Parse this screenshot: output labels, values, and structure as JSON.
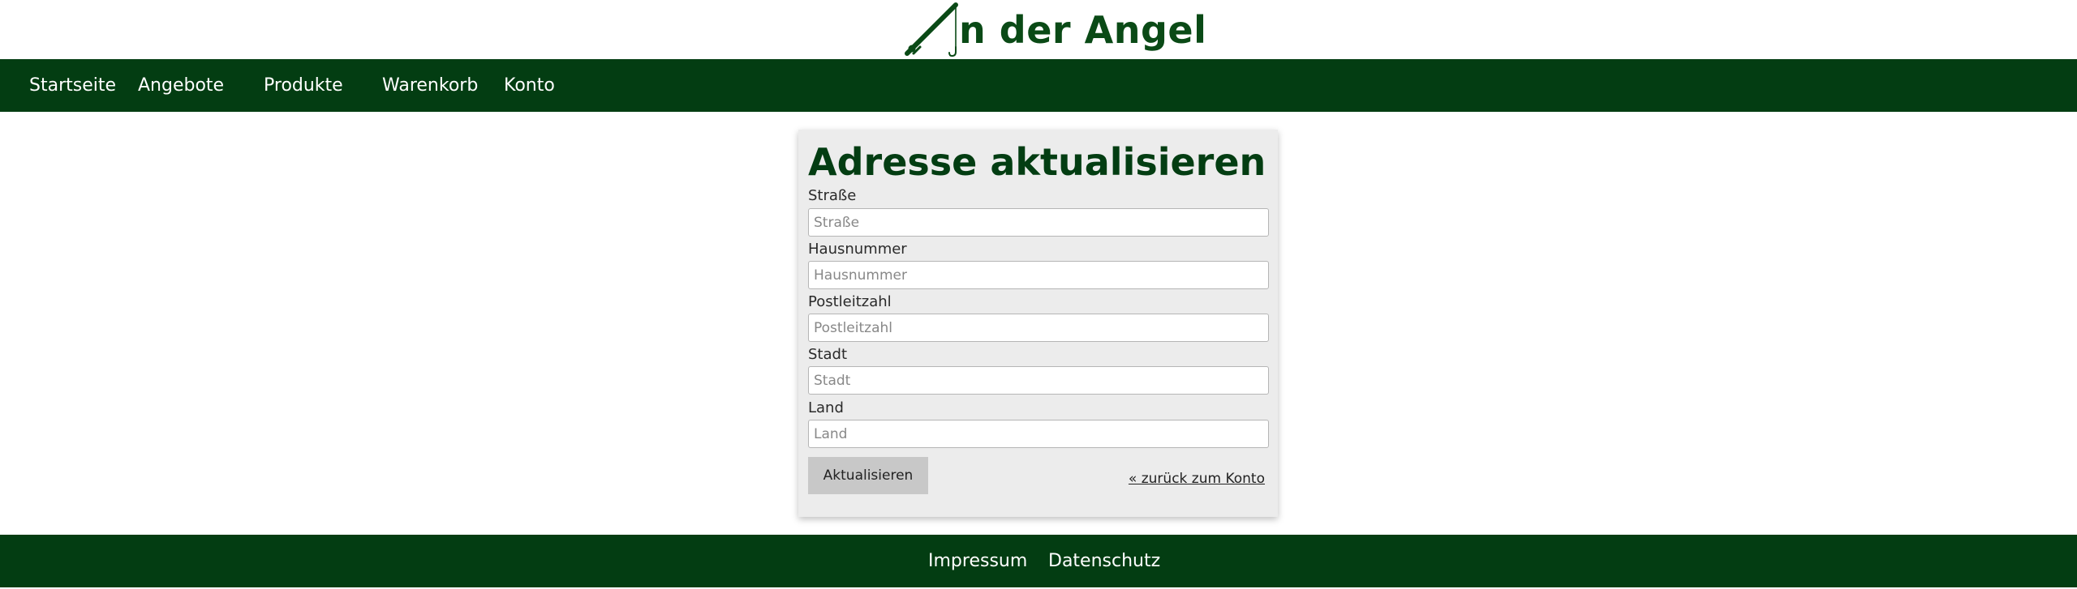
{
  "brand": {
    "logo_text": "n der Angel",
    "logo_icon": "fishing-rod-icon",
    "color": "#0a4a16"
  },
  "nav": {
    "items": [
      {
        "label": "Startseite"
      },
      {
        "label": "Angebote"
      },
      {
        "label": "Produkte"
      },
      {
        "label": "Warenkorb"
      },
      {
        "label": "Konto"
      }
    ],
    "background": "#033d12"
  },
  "form": {
    "title": "Adresse aktualisieren",
    "fields": [
      {
        "label": "Straße",
        "placeholder": "Straße",
        "value": ""
      },
      {
        "label": "Hausnummer",
        "placeholder": "Hausnummer",
        "value": ""
      },
      {
        "label": "Postleitzahl",
        "placeholder": "Postleitzahl",
        "value": ""
      },
      {
        "label": "Stadt",
        "placeholder": "Stadt",
        "value": ""
      },
      {
        "label": "Land",
        "placeholder": "Land",
        "value": ""
      }
    ],
    "submit_label": "Aktualisieren",
    "back_link": "« zurück zum Konto"
  },
  "footer": {
    "links": [
      {
        "label": "Impressum"
      },
      {
        "label": "Datenschutz"
      }
    ]
  }
}
